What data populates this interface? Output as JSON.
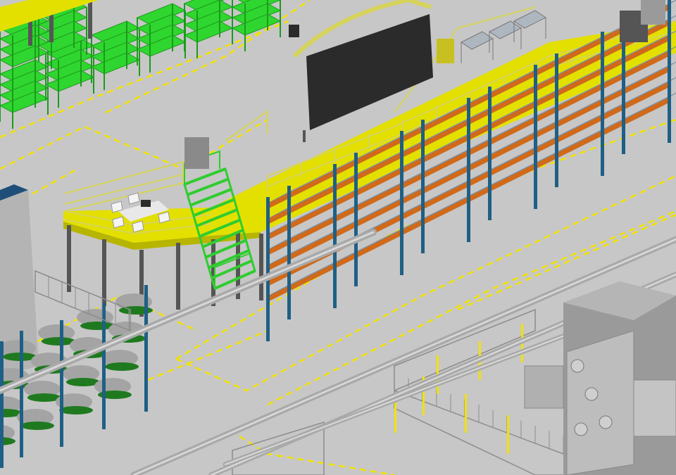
{
  "scene": {
    "floor_color": "#c7c7c7",
    "lane_marking_color": "#f2e200",
    "mezzanine_color": "#e3e000",
    "mezzanine_shadow_color": "#b7b500",
    "rail_color": "#d6d35a",
    "steel_post_color": "#555555",
    "rack_upright_color": "#1f5f85",
    "rack_beam_color": "#d06a1a",
    "rack_tube_color": "#8ea4b8",
    "green_shelf_color": "#2fd62f",
    "stair_color": "#2fcc2f",
    "pipe_color": "#a9a9a9",
    "fence_color": "#8c8c8c",
    "machine_color": "#9a9a9a",
    "bin_color": "#a4a4a4",
    "bin_leaf_color": "#1f7a1f",
    "dark_panel_color": "#2b2b2b",
    "desk_color": "#e8e8e8",
    "chair_color": "#f4f4f4",
    "tower_color": "#b4b4b4",
    "tower_cap_color": "#1e4f79"
  },
  "icons": {
    "mezzanine": "mezzanine-platform",
    "stair": "stair-icon",
    "rack": "pallet-rack",
    "machine": "industrial-machine",
    "pipe": "overhead-pipe",
    "fence": "safety-fence",
    "office": "office-desk"
  }
}
